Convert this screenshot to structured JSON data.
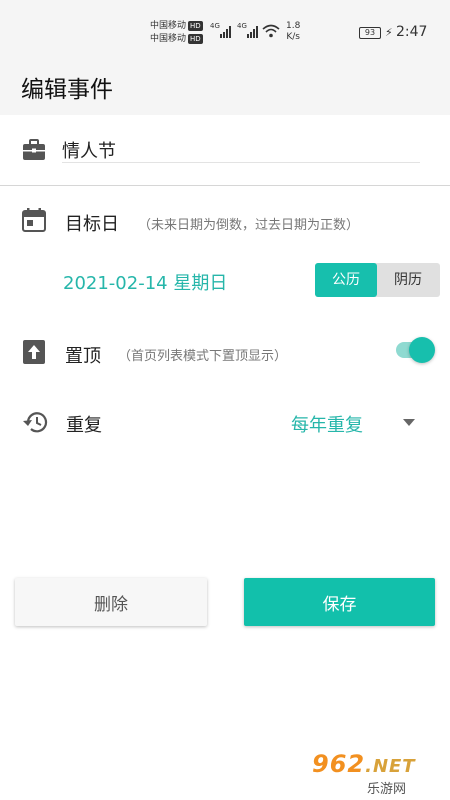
{
  "status_bar": {
    "carrier_1": "中国移动",
    "carrier_2": "中国移动",
    "hd_badge": "HD",
    "network_type": "4G",
    "speed_value": "1.8",
    "speed_unit": "K/s",
    "battery": "93",
    "time": "2:47"
  },
  "header": {
    "title": "编辑事件"
  },
  "event": {
    "icon": "briefcase-icon",
    "name_value": "情人节"
  },
  "target_date": {
    "icon": "calendar-icon",
    "label": "目标日",
    "hint": "（未来日期为倒数，过去日期为正数）",
    "date": "2021-02-14 星期日",
    "calendar_options": [
      "公历",
      "阴历"
    ],
    "selected_calendar": "公历"
  },
  "pin": {
    "icon": "pin-top-icon",
    "label": "置顶",
    "hint": "（首页列表模式下置顶显示）",
    "enabled": true
  },
  "repeat": {
    "icon": "history-icon",
    "label": "重复",
    "value": "每年重复"
  },
  "actions": {
    "delete_label": "删除",
    "save_label": "保存"
  },
  "watermark": {
    "brand": "962",
    "domain": ".NET",
    "site": "乐游网"
  },
  "colors": {
    "accent": "#17bfad",
    "accent_text": "#26b6aa",
    "toggle_track": "#8fdad1",
    "bar_bg": "#f5f5f5"
  }
}
